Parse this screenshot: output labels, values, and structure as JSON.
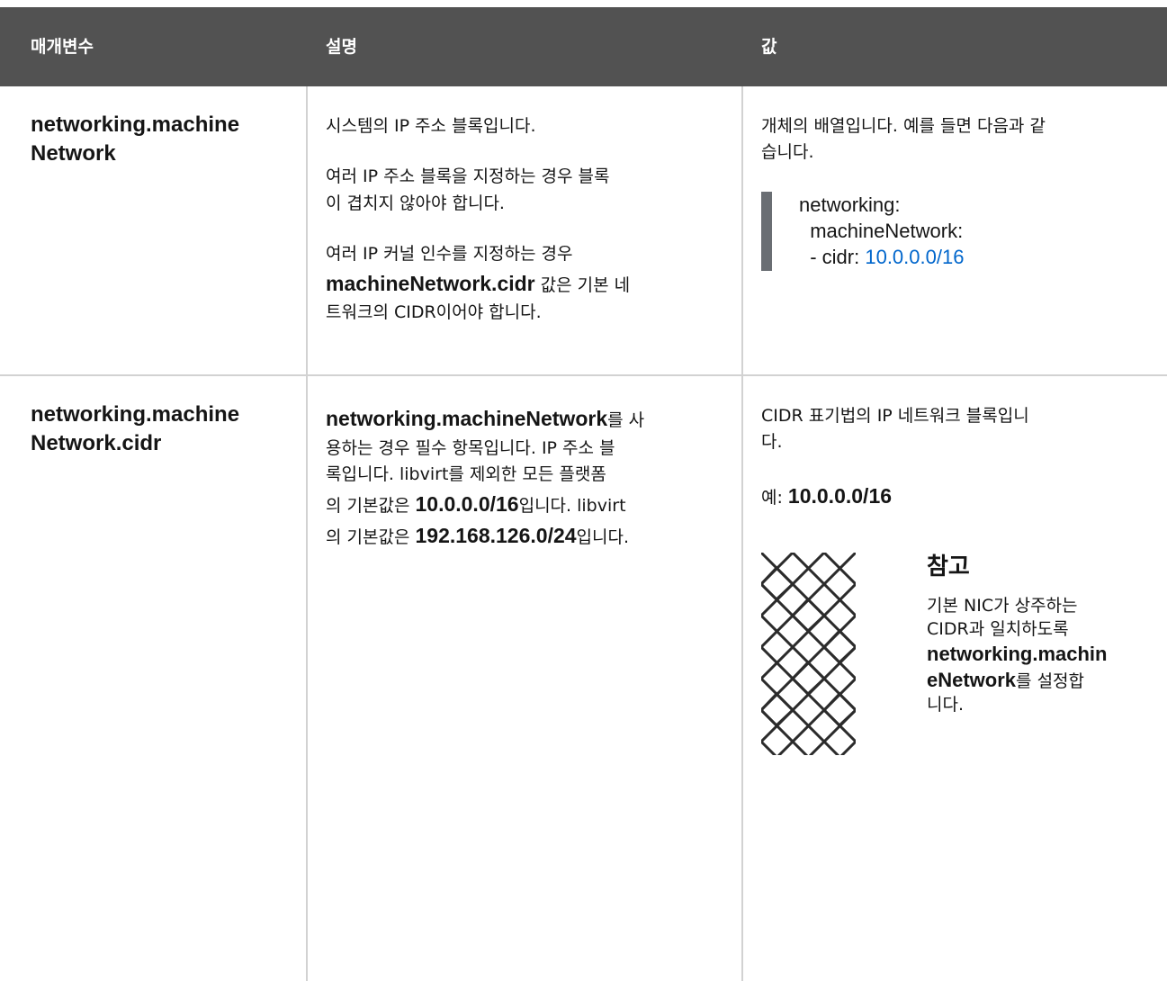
{
  "table": {
    "headers": {
      "parameter": "매개변수",
      "description": "설명",
      "value": "값"
    },
    "rows": [
      {
        "parameter_line1": "networking.machine",
        "parameter_line2": "Network",
        "description": {
          "p1": "시스템의 IP 주소 블록입니다.",
          "p2_line1": "여러 IP 주소 블록을 지정하는 경우 블록",
          "p2_line2": "이 겹치지 않아야 합니다.",
          "p3_line1": "여러 IP 커널 인수를 지정하는 경우",
          "p3_bold": "machineNetwork.cidr",
          "p3_line2_rest": " 값은 기본 네",
          "p3_line3": "트워크의 CIDR이어야 합니다."
        },
        "value": {
          "intro_line1": "개체의 배열입니다. 예를 들면 다음과 같",
          "intro_line2": "습니다.",
          "code_line1": "networking:",
          "code_line2": "  machineNetwork:",
          "code_line3_prefix": "  - cidr: ",
          "code_line3_link": "10.0.0.0/16"
        }
      },
      {
        "parameter_line1": "networking.machine",
        "parameter_line2": "Network.cidr",
        "description": {
          "line1_bold": "networking.machineNetwork",
          "line1_rest": "를 사",
          "line2": "용하는 경우 필수 항목입니다. IP 주소 블",
          "line3": "록입니다. libvirt를 제외한 모든 플랫폼",
          "line4_prefix": "의 기본값은 ",
          "line4_bold": "10.0.0.0/16",
          "line4_rest": "입니다. libvirt",
          "line5_prefix": "의 기본값은 ",
          "line5_bold": "192.168.126.0/24",
          "line5_rest": "입니다."
        },
        "value": {
          "line1": "CIDR 표기법의 IP 네트워크 블록입니",
          "line2": "다.",
          "example_prefix": "예: ",
          "example_value": "10.0.0.0/16",
          "note": {
            "icon": "note-pattern-icon",
            "title": "참고",
            "text_line1": "기본 NIC가 상주하는",
            "text_line2": "CIDR과 일치하도록",
            "bold_line1": "networking.machin",
            "bold_line2": "eNetwork",
            "text_after_bold": "를 설정합",
            "text_line_last": "니다."
          }
        }
      }
    ]
  },
  "colors": {
    "header_bg": "#525252",
    "border": "#d2d2d2",
    "code_bar": "#6a6e73",
    "link": "#0066cc"
  }
}
